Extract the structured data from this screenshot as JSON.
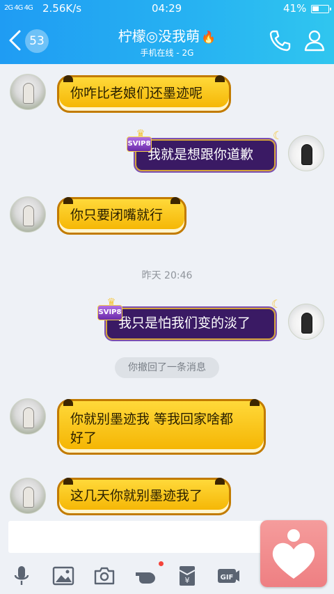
{
  "status_bar": {
    "signal": "2G 4G 4G",
    "net_speed": "2.56K/s",
    "time": "04:29",
    "battery": "41%"
  },
  "header": {
    "unread_count": "53",
    "contact_name": "柠檬◎没我萌",
    "status": "手机在线 - 2G",
    "fire_glyph": "🔥"
  },
  "messages": [
    {
      "side": "left",
      "text": "你咋比老娘们还墨迹呢"
    },
    {
      "side": "right",
      "text": "我就是想跟你道歉",
      "badge": "SVIP8"
    },
    {
      "side": "left",
      "text": "你只要闭嘴就行"
    },
    {
      "side": "right",
      "text": "我只是怕我们变的淡了",
      "badge": "SVIP8"
    },
    {
      "side": "left",
      "text_line1": "你就别墨迹我 等我回家啥都",
      "text_line2": "好了"
    },
    {
      "side": "left",
      "text": "这几天你就别墨迹我了"
    }
  ],
  "timestamp": "昨天 20:46",
  "recall_notice": "你撤回了一条消息",
  "input": {
    "value": "",
    "placeholder": ""
  },
  "toolbar": [
    "microphone-icon",
    "image-icon",
    "camera-icon",
    "poke-icon",
    "red-packet-icon",
    "gif-icon"
  ],
  "colors": {
    "header_start": "#1f9cf3",
    "header_end": "#30c6ef",
    "gold_bubble": "#f4b300",
    "svip_bubble": "#3a1a64",
    "overlay_app": "#ee7f82"
  }
}
